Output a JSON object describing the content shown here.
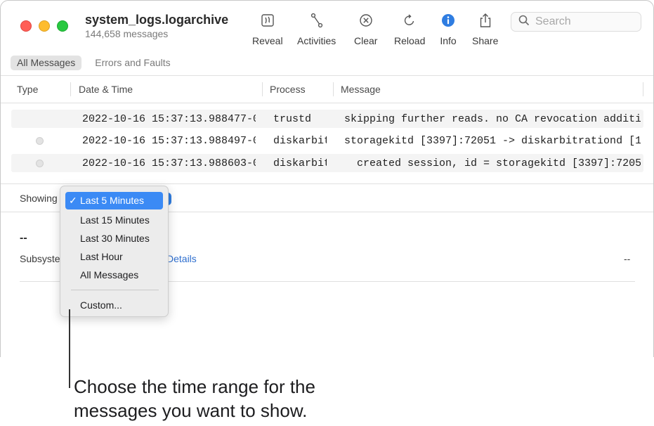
{
  "window": {
    "title": "system_logs.logarchive",
    "subtitle": "144,658 messages"
  },
  "toolbar": {
    "reveal_label": "Reveal",
    "activities_label": "Activities",
    "clear_label": "Clear",
    "reload_label": "Reload",
    "info_label": "Info",
    "share_label": "Share",
    "info_icon_color": "#2f7de1"
  },
  "search": {
    "placeholder": "Search",
    "value": ""
  },
  "filters": {
    "all_messages": "All Messages",
    "errors_and_faults": "Errors and Faults"
  },
  "columns": {
    "type": "Type",
    "datetime": "Date & Time",
    "process": "Process",
    "message": "Message"
  },
  "rows": [
    {
      "datetime": "2022-10-16 15:37:13.988477-0",
      "process": "trustd",
      "message": "skipping further reads. no CA revocation additi"
    },
    {
      "datetime": "2022-10-16 15:37:13.988497-0",
      "process": "diskarbitrationd",
      "message": "storagekitd [3397]:72051 -> diskarbitrationd [1"
    },
    {
      "datetime": "2022-10-16 15:37:13.988603-0",
      "process": "diskarbitrationd",
      "message": "  created session, id = storagekitd [3397]:7205"
    }
  ],
  "showing": {
    "label": "Showing"
  },
  "detail": {
    "placeholder": "--",
    "subsystem_label": "Subsystem",
    "details_link": "Details",
    "right_value": "--"
  },
  "time_menu": {
    "check_mark": "✓",
    "items": [
      "Last 5 Minutes",
      "Last 15 Minutes",
      "Last 30 Minutes",
      "Last Hour",
      "All Messages"
    ],
    "custom": "Custom...",
    "selected_color": "#3b8af5"
  },
  "callout": {
    "line1": "Choose the time range for the",
    "line2": "messages you want to show."
  }
}
